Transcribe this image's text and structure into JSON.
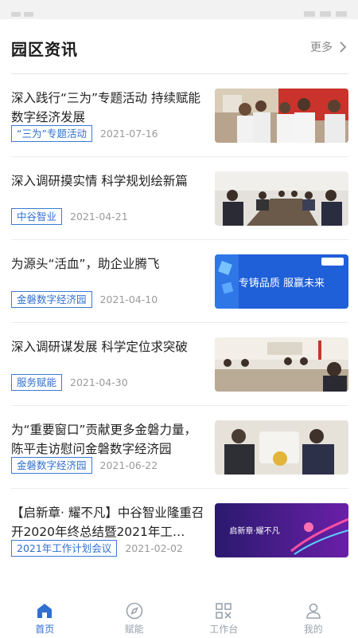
{
  "header": {
    "title": "园区资讯",
    "more_label": "更多"
  },
  "news": [
    {
      "title": "深入践行“三为”专题活动 持续赋能数字经济发展",
      "tag": "“三为”专题活动",
      "date": "2021-07-16",
      "image_icon": "meeting-photo"
    },
    {
      "title": "深入调研摸实情 科学规划绘新篇",
      "tag": "中谷智业",
      "date": "2021-04-21",
      "image_icon": "conference-photo"
    },
    {
      "title": "为源头“活血”，助企业腾飞",
      "tag": "金磐数字经济园",
      "date": "2021-04-10",
      "image_icon": "banner-graphic",
      "image_banner_text": "专铸品质    服赢未来"
    },
    {
      "title": "深入调研谋发展 科学定位求突破",
      "tag": "服务赋能",
      "date": "2021-04-30",
      "image_icon": "conference-photo"
    },
    {
      "title": "为“重要窗口”贡献更多金磐力量，陈平走访慰问金磐数字经济园",
      "tag": "金磐数字经济园",
      "date": "2021-06-22",
      "image_icon": "visit-photo"
    },
    {
      "title": "【启新章· 耀不凡】中谷智业隆重召开2020年终总结暨2021年工…",
      "tag": "2021年工作计划会议",
      "date": "2021-02-02",
      "image_icon": "banner-graphic",
      "image_banner_text": "启新章·耀不凡"
    }
  ],
  "tabs": [
    {
      "label": "首页",
      "icon": "home-icon",
      "active": true
    },
    {
      "label": "赋能",
      "icon": "compass-icon",
      "active": false
    },
    {
      "label": "工作台",
      "icon": "grid-icon",
      "active": false
    },
    {
      "label": "我的",
      "icon": "user-icon",
      "active": false
    }
  ],
  "colors": {
    "accent": "#2f6fd0",
    "tab_inactive": "#9aa3ad"
  }
}
